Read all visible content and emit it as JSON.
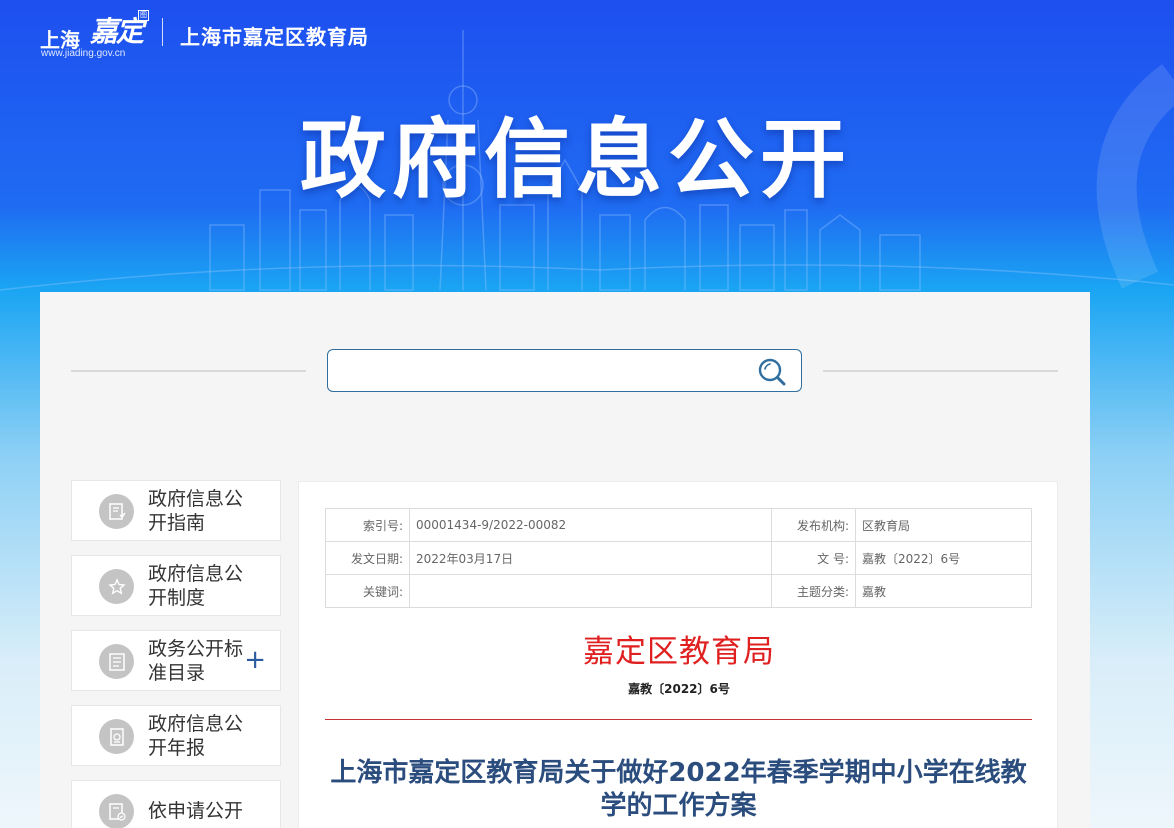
{
  "header": {
    "logo_sh": "上海",
    "logo_jd": "嘉定",
    "logo_seal": "图",
    "logo_url": "www.jiading.gov.cn",
    "org_name": "上海市嘉定区教育局",
    "banner_title": "政府信息公开"
  },
  "search": {
    "value": "",
    "placeholder": ""
  },
  "sidebar": {
    "items": [
      {
        "label": "政府信息公开指南",
        "icon": "guide-doc-icon"
      },
      {
        "label": "政府信息公开制度",
        "icon": "star-badge-icon"
      },
      {
        "label": "政务公开标准目录",
        "icon": "list-doc-icon",
        "expand": "+"
      },
      {
        "label": "政府信息公开年报",
        "icon": "report-icon"
      },
      {
        "label": "依申请公开",
        "icon": "apply-check-icon"
      }
    ]
  },
  "meta": {
    "rows": [
      {
        "k1": "索引号:",
        "v1": "00001434-9/2022-00082",
        "k2": "发布机构:",
        "v2": "区教育局"
      },
      {
        "k1": "发文日期:",
        "v1": "2022年03月17日",
        "k2": "文 号:",
        "v2": "嘉教〔2022〕6号"
      },
      {
        "k1": "关键词:",
        "v1": "",
        "k2": "主题分类:",
        "v2": "嘉教"
      }
    ]
  },
  "document": {
    "issuer": "嘉定区教育局",
    "number": "嘉教〔2022〕6号",
    "title": "上海市嘉定区教育局关于做好2022年春季学期中小学在线教学的工作方案"
  },
  "colors": {
    "accent": "#2b4d7e",
    "issuer_red": "#e02020",
    "rule_red": "#c83232"
  }
}
